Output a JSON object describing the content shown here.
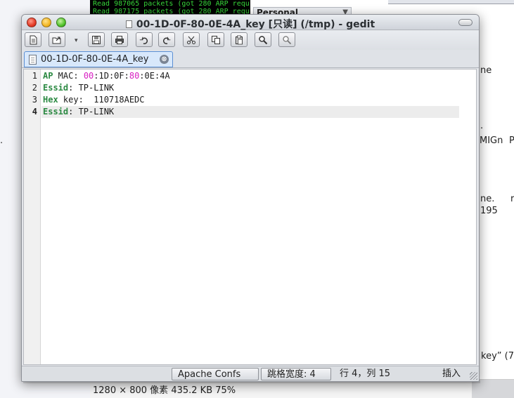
{
  "background": {
    "terminal_lines": [
      "Read 987065 packets (got 280 ARP requ",
      "Read 987175 packets (got 280 ARP requ"
    ],
    "panel_title": "Personal",
    "right_fragments": [
      "ne",
      ".",
      "MIGn",
      "P",
      "ne.",
      "r",
      "195",
      "key” (7"
    ],
    "left_fragment": ".",
    "image_info": "1280 × 800 像素  435.2 KB   75%"
  },
  "window": {
    "title": "00-1D-0F-80-0E-4A_key [只读] (/tmp) - gedit"
  },
  "toolbar": {
    "buttons": [
      {
        "name": "new-document-button",
        "icon": "new-document-icon"
      },
      {
        "name": "open-button",
        "icon": "open-folder-icon"
      },
      {
        "name": "save-button",
        "icon": "save-icon"
      },
      {
        "name": "print-button",
        "icon": "print-icon"
      },
      {
        "name": "undo-button",
        "icon": "undo-icon"
      },
      {
        "name": "redo-button",
        "icon": "redo-icon"
      },
      {
        "name": "cut-button",
        "icon": "cut-icon"
      },
      {
        "name": "copy-button",
        "icon": "copy-icon"
      },
      {
        "name": "paste-button",
        "icon": "paste-icon"
      },
      {
        "name": "find-button",
        "icon": "find-icon"
      },
      {
        "name": "replace-button",
        "icon": "replace-icon"
      }
    ]
  },
  "tab": {
    "label": "00-1D-0F-80-0E-4A_key",
    "close_glyph": "⊗"
  },
  "editor": {
    "lines": [
      {
        "number": "1",
        "parts": [
          [
            "k",
            "AP"
          ],
          [
            "t",
            " MAC: "
          ],
          [
            "m",
            "00"
          ],
          [
            "t",
            ":1D:0F:"
          ],
          [
            "m",
            "80"
          ],
          [
            "t",
            ":0E:4A"
          ]
        ]
      },
      {
        "number": "2",
        "parts": [
          [
            "k",
            "Essid"
          ],
          [
            "t",
            ": TP-LINK"
          ]
        ]
      },
      {
        "number": "3",
        "parts": [
          [
            "k",
            "Hex"
          ],
          [
            "t",
            " key:  110718AEDC"
          ]
        ]
      },
      {
        "number": "4",
        "parts": [
          [
            "k",
            "Essid"
          ],
          [
            "t",
            ": TP-LINK"
          ]
        ]
      }
    ],
    "current_line": 4
  },
  "statusbar": {
    "language": "Apache Confs",
    "tab_width": "跳格宽度: 4",
    "position": "行 4，列 15",
    "mode": "插入"
  },
  "colors": {
    "keyword": "#2c8a43",
    "magenta_number": "#d81fc2",
    "tab_accent": "#5b8fd4"
  }
}
